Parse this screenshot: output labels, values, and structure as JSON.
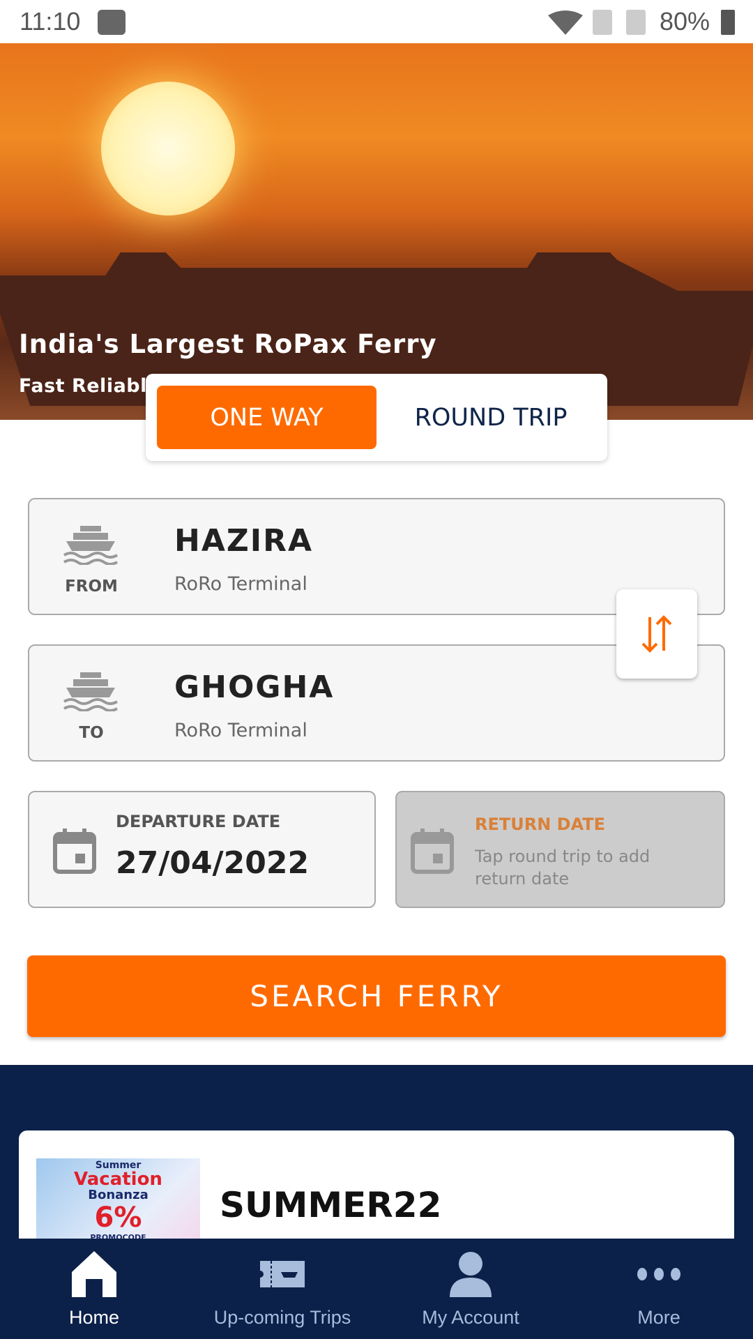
{
  "status_bar": {
    "time": "11:10",
    "battery": "80%"
  },
  "hero": {
    "title": "India's Largest RoPax Ferry",
    "subtitle": "Fast Reliable Easy"
  },
  "trip_type": {
    "one_way": "ONE WAY",
    "round_trip": "ROUND TRIP",
    "selected": "ONE WAY"
  },
  "from": {
    "label": "FROM",
    "place": "HAZIRA",
    "terminal": "RoRo Terminal"
  },
  "to": {
    "label": "TO",
    "place": "GHOGHA",
    "terminal": "RoRo Terminal"
  },
  "departure": {
    "label": "DEPARTURE DATE",
    "value": "27/04/2022"
  },
  "return": {
    "label": "RETURN DATE",
    "hint": "Tap round trip to add return date"
  },
  "search_button": "SEARCH FERRY",
  "promo": {
    "code": "SUMMER22",
    "image_text": {
      "line1": "Summer",
      "line2": "Vacation",
      "line3": "Bonanza",
      "discount": "6%",
      "line4": "PROMOCODE"
    }
  },
  "bottom_nav": [
    {
      "label": "Home",
      "icon": "home-icon",
      "active": true
    },
    {
      "label": "Up-coming Trips",
      "icon": "ticket-icon"
    },
    {
      "label": "My Account",
      "icon": "user-icon"
    },
    {
      "label": "More",
      "icon": "more-icon"
    }
  ],
  "colors": {
    "accent": "#ff6a00",
    "navy": "#0c2149",
    "nav_inactive": "#a8bcdc",
    "return_label": "#d9813a"
  }
}
